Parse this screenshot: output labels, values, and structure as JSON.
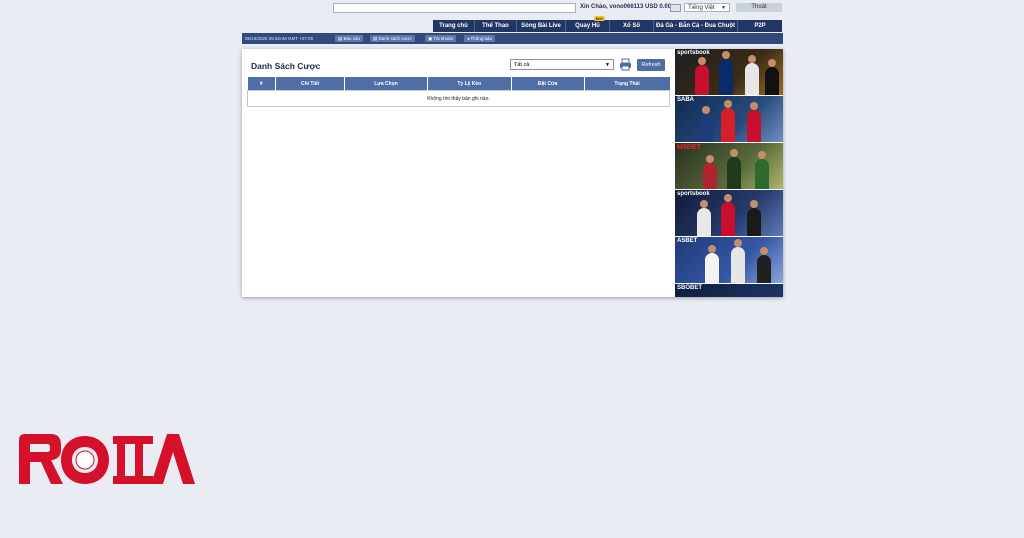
{
  "header": {
    "greeting": "Xin Chào, vono066113 USD 0.00",
    "language": "Tiếng Việt",
    "logout_label": "Thoát",
    "mail_icon": "mail-icon"
  },
  "nav": {
    "items": [
      {
        "label": "Trang chủ"
      },
      {
        "label": "Thể Thao"
      },
      {
        "label": "Sòng Bài Live"
      },
      {
        "label": "Quay Hũ",
        "badge": "Mới"
      },
      {
        "label": "Xổ Số"
      },
      {
        "label": "Đá Gà - Bắn Cá - Đua Chuột"
      },
      {
        "label": "P2P"
      }
    ]
  },
  "subbar": {
    "datetime": "05/18/2026 05:52AM GMT +07:00",
    "buttons": [
      {
        "label": "Báo cáo",
        "icon": "document-icon"
      },
      {
        "label": "Danh sách cược",
        "icon": "list-icon"
      },
      {
        "label": "Tài khoản",
        "icon": "user-icon"
      },
      {
        "label": "Thông báo",
        "icon": "megaphone-icon"
      }
    ]
  },
  "main": {
    "title": "Danh Sách Cược",
    "filter_value": "Tất cả",
    "refresh_label": "Refresh",
    "print_icon": "printer-icon",
    "table": {
      "headers": [
        "#",
        "Chi Tiết",
        "Lựa Chọn",
        "Tỷ Lệ Kèo",
        "Đặt Cửa",
        "Trạng Thái"
      ],
      "empty_message": "Không tìm thấy bản ghi nào."
    }
  },
  "banners": [
    {
      "label": "sportsbook"
    },
    {
      "label": "SABA"
    },
    {
      "label": "M9BET"
    },
    {
      "label": "sportsbook"
    },
    {
      "label": "ASBET"
    },
    {
      "label": "SBOBET"
    }
  ],
  "watermark": {
    "text": "ROMA"
  },
  "colors": {
    "nav": "#203663",
    "table_header": "#4e6ea6",
    "logo_red": "#d5102a"
  }
}
